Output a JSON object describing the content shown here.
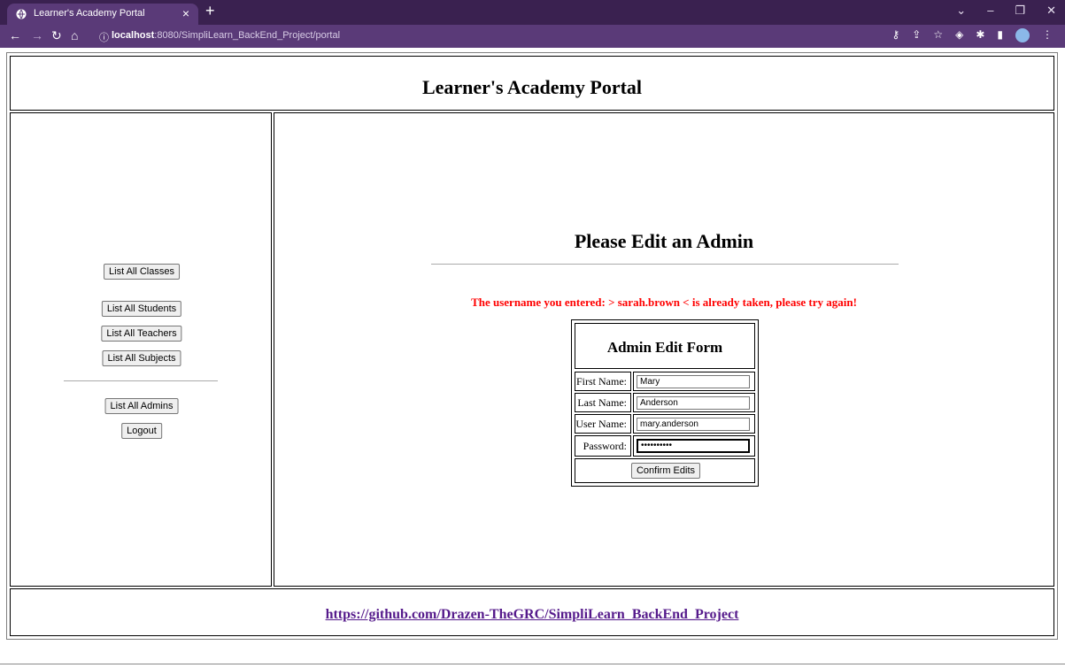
{
  "browser": {
    "tab_title": "Learner's Academy Portal",
    "tab_close": "×",
    "new_tab": "+",
    "url_host": "localhost",
    "url_rest": ":8080/SimpliLearn_BackEnd_Project/portal"
  },
  "header": {
    "title": "Learner's Academy Portal"
  },
  "sidebar": {
    "list_classes": "List All Classes",
    "list_students": "List All Students",
    "list_teachers": "List All Teachers",
    "list_subjects": "List All Subjects",
    "list_admins": "List All Admins",
    "logout": "Logout"
  },
  "main": {
    "heading": "Please Edit an Admin",
    "error": "The username you entered: > sarah.brown < is already taken, please try again!",
    "form": {
      "title": "Admin Edit Form",
      "first_name_label": "First Name:",
      "first_name_value": "Mary",
      "last_name_label": "Last Name:",
      "last_name_value": "Anderson",
      "user_name_label": "User Name:",
      "user_name_value": "mary.anderson",
      "password_label": "Password:",
      "password_value": "••••••••••",
      "confirm_label": "Confirm Edits"
    }
  },
  "footer": {
    "link": "https://github.com/Drazen-TheGRC/SimpliLearn_BackEnd_Project"
  },
  "colors": {
    "chrome_dark": "#3a2150",
    "chrome": "#5a3a78",
    "error": "#ff0000",
    "link": "#551a8b"
  }
}
